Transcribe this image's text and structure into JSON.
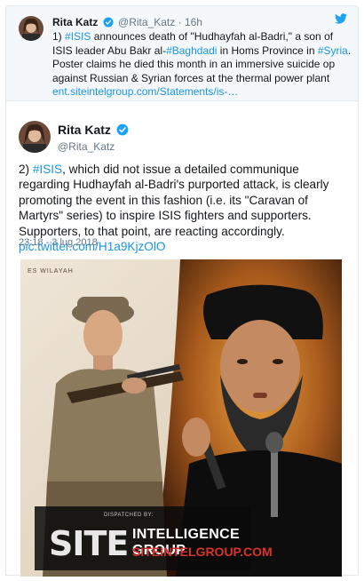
{
  "reply_tweet": {
    "author_name": "Rita Katz",
    "handle": "@Rita_Katz",
    "separator": "·",
    "time_ago": "16h",
    "text_segments": [
      {
        "t": "1) ",
        "link": false
      },
      {
        "t": "#ISIS",
        "link": true
      },
      {
        "t": " announces death of \"Hudhayfah al-Badri,\" a son of ISIS leader Abu Bakr al-",
        "link": false
      },
      {
        "t": "#Baghdadi",
        "link": true
      },
      {
        "t": " in Homs Province in ",
        "link": false
      },
      {
        "t": "#Syria",
        "link": true
      },
      {
        "t": ". Poster claims he died this month in an immersive suicide op against Russian & Syrian forces at the thermal power plant ",
        "link": false
      },
      {
        "t": "ent.siteintelgroup.com/Statements/is-…",
        "link": true
      }
    ]
  },
  "main_tweet": {
    "author_name": "Rita Katz",
    "handle": "@Rita_Katz",
    "text_segments": [
      {
        "t": "2) ",
        "link": false
      },
      {
        "t": "#ISIS",
        "link": true
      },
      {
        "t": ", which did not issue a detailed communique regarding Hudhayfah al-Badri's purported attack, is clearly promoting the event in this fashion (i.e. its \"Caravan of Martyrs\" series) to inspire ISIS fighters and supporters. Supporters, to that point, are reacting accordingly. ",
        "link": false
      },
      {
        "t": "pic.twitter.com/H1a9KjzOlO",
        "link": true
      }
    ],
    "timestamp": "23:18 - 3 lug 2018"
  },
  "media": {
    "corner_text": "ES WILAYAH",
    "watermark": {
      "dispatched_by": "DISPATCHED BY:",
      "brand": "SITE",
      "org": "INTELLIGENCE GROUP",
      "url": "SITEINTELGROUP.COM"
    }
  },
  "colors": {
    "link": "#1b95e0",
    "verified": "#1da1f2",
    "muted": "#657786",
    "site_red": "#d9322a"
  }
}
